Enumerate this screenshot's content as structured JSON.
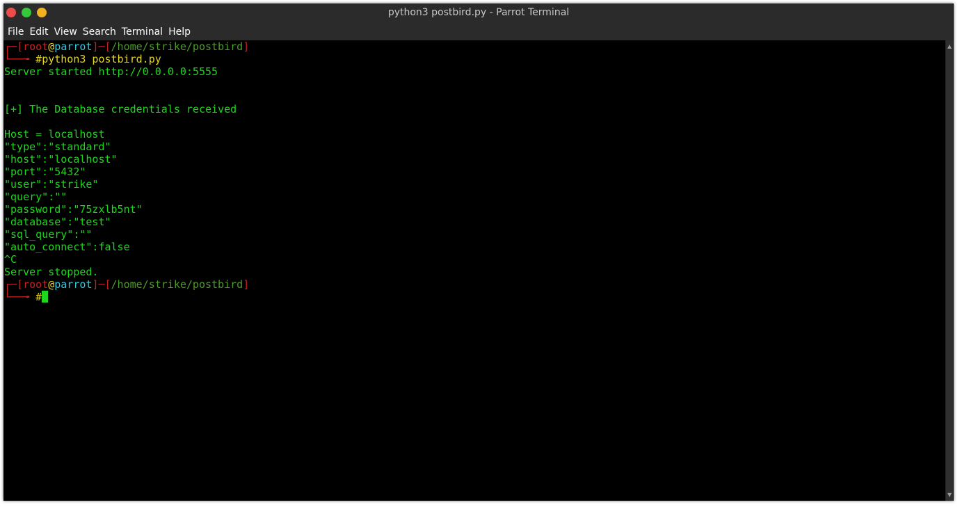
{
  "window": {
    "title": "python3 postbird.py - Parrot Terminal",
    "colors": {
      "close": "#ee4b4b",
      "maximize": "#34c83a",
      "minimize": "#f3b21f"
    }
  },
  "menu": {
    "items": [
      "File",
      "Edit",
      "View",
      "Search",
      "Terminal",
      "Help"
    ]
  },
  "terminal": {
    "prompt1": {
      "bracket_open": "┌─[",
      "user": "root",
      "at": "@",
      "host": "parrot",
      "sep": "]─[",
      "path": "/home/strike/postbird",
      "bracket_close": "]",
      "corner": "└──╼ ",
      "hash": "#",
      "command": "python3 postbird.py"
    },
    "output": [
      "Server started http://0.0.0.0:5555",
      "",
      "",
      "[+] The Database credentials received",
      "",
      "Host = localhost",
      "\"type\":\"standard\"",
      "\"host\":\"localhost\"",
      "\"port\":\"5432\"",
      "\"user\":\"strike\"",
      "\"query\":\"\"",
      "\"password\":\"75zxlb5nt\"",
      "\"database\":\"test\"",
      "\"sql_query\":\"\"",
      "\"auto_connect\":false",
      "^C",
      "Server stopped."
    ],
    "prompt2": {
      "bracket_open": "┌─[",
      "user": "root",
      "at": "@",
      "host": "parrot",
      "sep": "]─[",
      "path": "/home/strike/postbird",
      "bracket_close": "]",
      "corner": "└──╼ ",
      "hash": "#"
    },
    "cursor_color": "#1dd61d"
  }
}
